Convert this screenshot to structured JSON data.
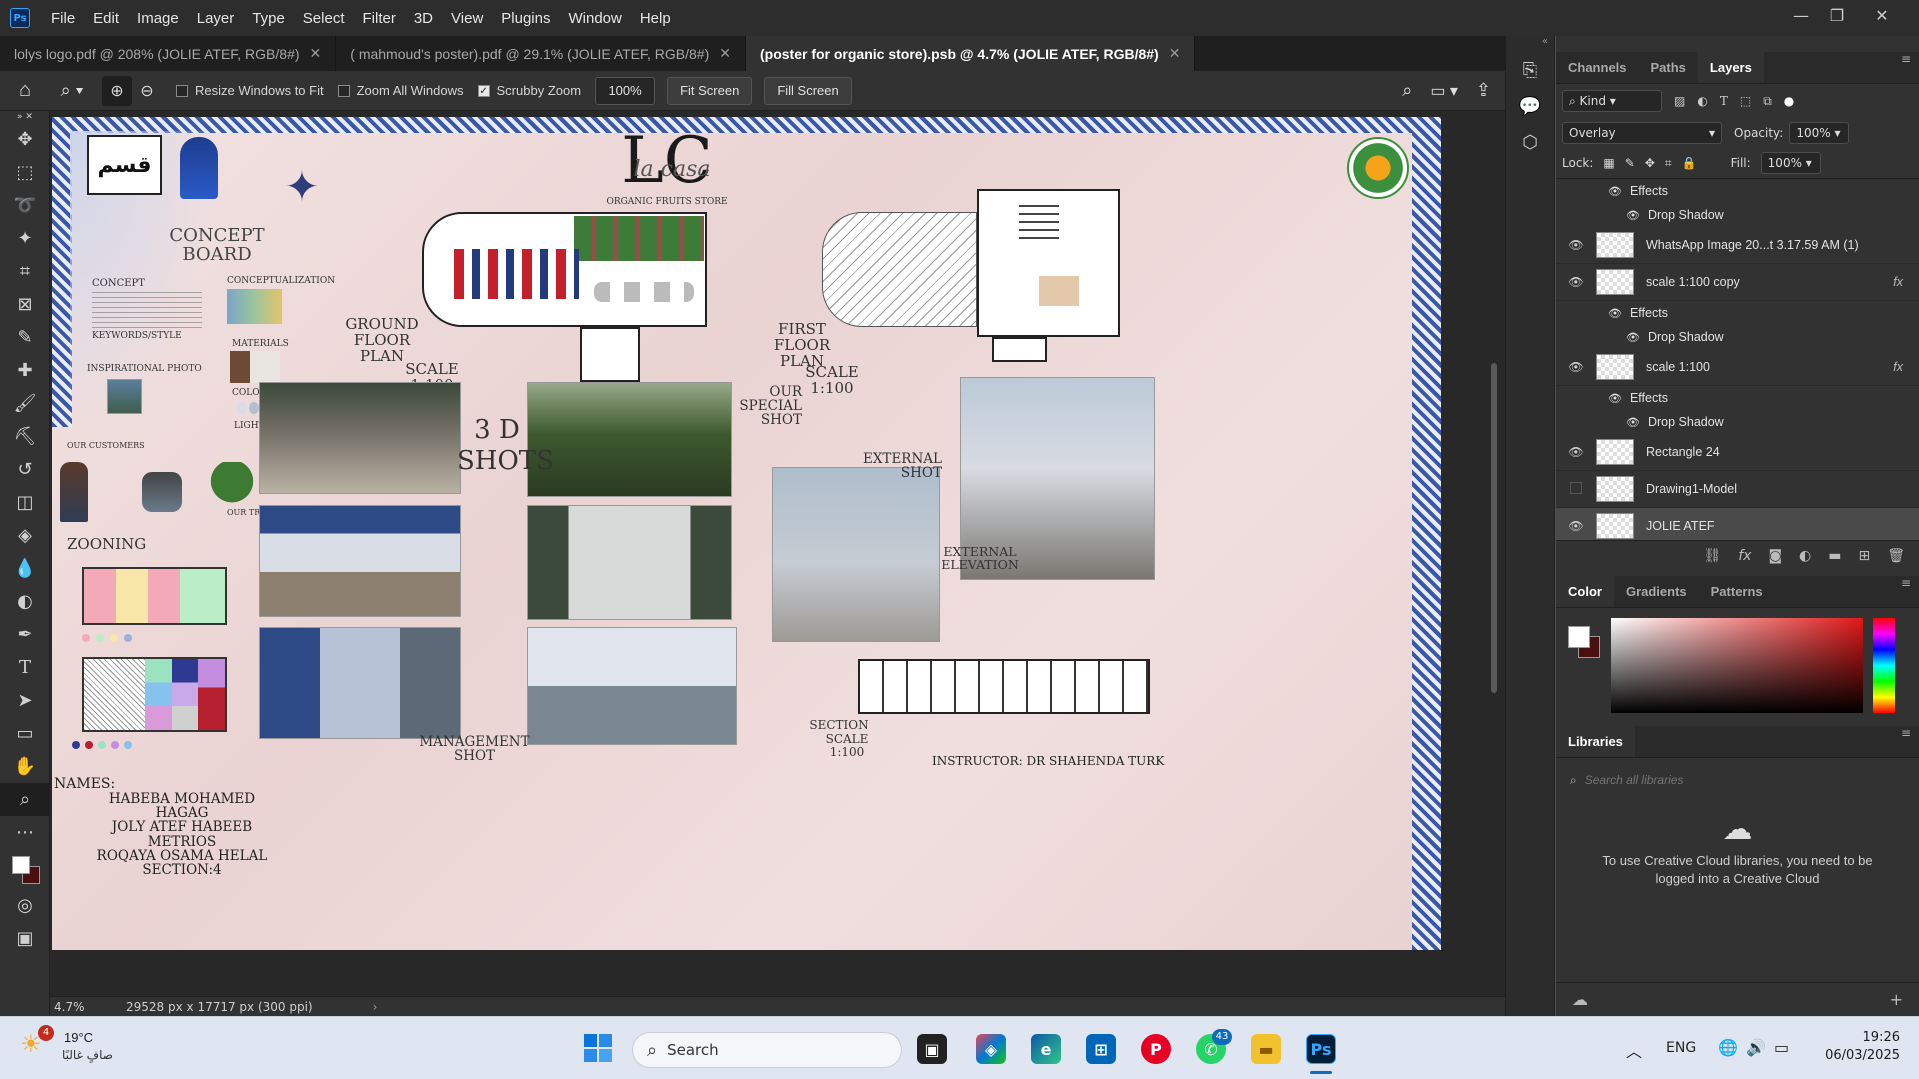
{
  "app": {
    "name": "Photoshop",
    "logo_text": "Ps"
  },
  "menu": [
    "File",
    "Edit",
    "Image",
    "Layer",
    "Type",
    "Select",
    "Filter",
    "3D",
    "View",
    "Plugins",
    "Window",
    "Help"
  ],
  "window_controls": {
    "minimize": "—",
    "restore": "❐",
    "close": "✕"
  },
  "tabs": [
    {
      "label": "lolys logo.pdf @ 208% (JOLIE ATEF, RGB/8#)",
      "active": false
    },
    {
      "label": "( mahmoud's poster).pdf @ 29.1% (JOLIE ATEF, RGB/8#)",
      "active": false
    },
    {
      "label": "(poster for organic store).psb @ 4.7% (JOLIE ATEF, RGB/8#)",
      "active": true
    }
  ],
  "options": {
    "resize_windows": "Resize Windows to Fit",
    "zoom_all": "Zoom All Windows",
    "scrubby_zoom": "Scrubby Zoom",
    "zoom_value": "100%",
    "fit_screen": "Fit Screen",
    "fill_screen": "Fill Screen"
  },
  "status": {
    "zoom": "4.7%",
    "doc_size": "29528 px x 17717 px (300 ppi)"
  },
  "poster": {
    "concept_board": "CONCEPT BOARD",
    "logo_main": "LC",
    "logo_script": "la casa",
    "logo_sub": "ORGANIC FRUITS STORE",
    "concept": "CONCEPT",
    "conceptualization": "CONCEPTUALIZATION",
    "keywords": "KEYWORDS/STYLE",
    "inspirational": "INSPIRATIONAL PHOTO",
    "materials": "MATERIALS",
    "color_scheme": "COLOR SCHEME",
    "lighting": "LIGHTING",
    "customers": "OUR CUSTOMERS",
    "trees": "OUR TREES",
    "zooning": "ZOONING",
    "ground_floor": "GROUND FLOOR PLAN",
    "ground_scale": "SCALE 1:100",
    "first_floor": "FIRST FLOOR PLAN",
    "first_scale": "SCALE 1:100",
    "shots_3d": "3 D SHOTS",
    "special_shot": "OUR SPECIAL SHOT",
    "external_shot": "EXTERNAL SHOT",
    "external_elevation": "EXTERNAL ELEVATION",
    "management_shot": "MANAGEMENT SHOT",
    "section": "SECTION",
    "section_scale": "SCALE 1:100",
    "names_title": "NAMES:",
    "names": [
      "HABEBA MOHAMED HAGAG",
      "JOLY ATEF HABEEB METRIOS",
      "ROQAYA OSAMA HELAL",
      "SECTION:4"
    ],
    "instructor": "INSTRUCTOR: DR SHAHENDA TURK"
  },
  "layers_panel": {
    "tabs": [
      "Channels",
      "Paths",
      "Layers"
    ],
    "kind": "Kind",
    "blend_mode": "Overlay",
    "opacity_label": "Opacity:",
    "opacity": "100%",
    "lock_label": "Lock:",
    "fill_label": "Fill:",
    "fill": "100%",
    "rows": [
      {
        "type": "sub",
        "name": "Effects",
        "visible": true
      },
      {
        "type": "sub2",
        "name": "Drop Shadow",
        "visible": true
      },
      {
        "type": "layer",
        "name": "WhatsApp Image 20...t 3.17.59 AM (1)",
        "visible": true,
        "fx": false
      },
      {
        "type": "layer",
        "name": "scale  1:100 copy",
        "visible": true,
        "fx": true
      },
      {
        "type": "sub",
        "name": "Effects",
        "visible": true
      },
      {
        "type": "sub2",
        "name": "Drop Shadow",
        "visible": true
      },
      {
        "type": "layer",
        "name": "scale  1:100",
        "visible": true,
        "fx": true
      },
      {
        "type": "sub",
        "name": "Effects",
        "visible": true
      },
      {
        "type": "sub2",
        "name": "Drop Shadow",
        "visible": true
      },
      {
        "type": "layer",
        "name": "Rectangle 24",
        "visible": true,
        "fx": false
      },
      {
        "type": "layer",
        "name": "Drawing1-Model",
        "visible": false,
        "fx": false
      },
      {
        "type": "layer",
        "name": "JOLIE ATEF",
        "visible": true,
        "fx": false,
        "selected": true
      }
    ]
  },
  "color_panel": {
    "tabs": [
      "Color",
      "Gradients",
      "Patterns"
    ]
  },
  "libraries_panel": {
    "title": "Libraries",
    "search_placeholder": "Search all libraries",
    "message": "To use Creative Cloud libraries, you need to be logged into a Creative Cloud"
  },
  "taskbar": {
    "weather_temp": "19°C",
    "weather_text": "صافٍ غالبًا",
    "weather_badge": "4",
    "search": "Search",
    "whatsapp_badge": "43",
    "lang": "ENG",
    "time": "19:26",
    "date": "06/03/2025"
  },
  "colors": {
    "accent": "#31a8ff",
    "tile_blue": "#3b58a8",
    "poster_bg": "#ecd9d8"
  }
}
